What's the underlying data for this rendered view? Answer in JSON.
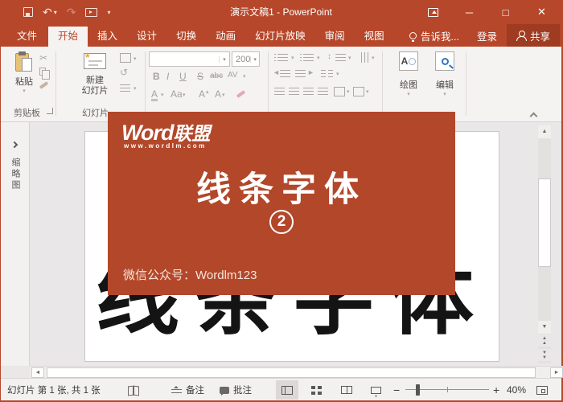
{
  "colors": {
    "chrome": "#b7472a",
    "banner": "#b34729",
    "share_button": "#9e3b20"
  },
  "title_bar": {
    "title": "演示文稿1 - PowerPoint"
  },
  "tabs": [
    {
      "label": "文件"
    },
    {
      "label": "开始",
      "active": true
    },
    {
      "label": "插入"
    },
    {
      "label": "设计"
    },
    {
      "label": "切换"
    },
    {
      "label": "动画"
    },
    {
      "label": "幻灯片放映"
    },
    {
      "label": "审阅"
    },
    {
      "label": "视图"
    }
  ],
  "tabs_right": {
    "tell_me": "告诉我...",
    "sign_in": "登录",
    "share": "共享"
  },
  "ribbon": {
    "clipboard": {
      "paste": "粘贴",
      "group_label": "剪贴板"
    },
    "slides": {
      "new_slide_line1": "新建",
      "new_slide_line2": "幻灯片",
      "group_label": "幻灯片"
    },
    "font": {
      "font_name": "",
      "font_size": "200",
      "bold": "B",
      "italic": "I",
      "underline": "U",
      "strike": "S",
      "clear_chars": "abc",
      "char_spacing": "AV",
      "font_color": "A",
      "change_case": "Aa",
      "grow_font": "A",
      "shrink_font": "A"
    },
    "drawing": {
      "label": "绘图",
      "icon_letter": "A"
    },
    "editing": {
      "label": "编辑"
    }
  },
  "thumbnail_pane": {
    "label": "缩略图"
  },
  "slide": {
    "heading": "线条字体"
  },
  "overlay": {
    "logo_word": "Word",
    "logo_cn": "联盟",
    "logo_url": "www.wordlm.com",
    "heading": "线条字体",
    "badge": "2",
    "footer": "微信公众号：Wordlm123"
  },
  "status_bar": {
    "slide_counter": "幻灯片 第 1 张, 共 1 张",
    "notes": "备注",
    "comments": "批注",
    "zoom_minus": "−",
    "zoom_plus": "+",
    "zoom_level": "40%"
  }
}
